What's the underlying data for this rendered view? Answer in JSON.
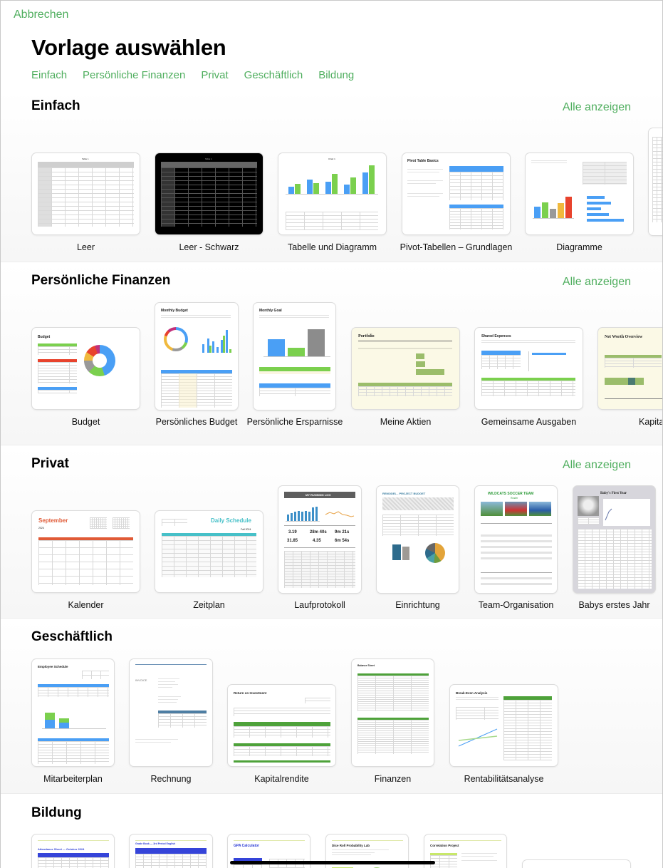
{
  "header": {
    "cancel_label": "Abbrechen",
    "title": "Vorlage auswählen",
    "categories": [
      "Einfach",
      "Persönliche Finanzen",
      "Privat",
      "Geschäftlich",
      "Bildung"
    ]
  },
  "colors": {
    "accent": "#4fae5e",
    "background": "#ffffff",
    "section_gradient_end": "#f6f6f6"
  },
  "sections": [
    {
      "title": "Einfach",
      "show_all": "Alle anzeigen",
      "templates": [
        {
          "label": "Leer",
          "preview_title": "Table 1"
        },
        {
          "label": "Leer - Schwarz",
          "preview_title": "Table 1"
        },
        {
          "label": "Tabelle und Diagramm",
          "preview_title": "Chart 1"
        },
        {
          "label": "Pivot-Tabellen – Grundlagen",
          "preview_title": "Pivot Table Basics"
        },
        {
          "label": "Diagramme",
          "preview_title": "Column Chart"
        }
      ]
    },
    {
      "title": "Persönliche Finanzen",
      "show_all": "Alle anzeigen",
      "templates": [
        {
          "label": "Budget",
          "preview_title": "Budget"
        },
        {
          "label": "Persönliches Budget",
          "preview_title": "Monthly Budget"
        },
        {
          "label": "Persönliche Ersparnisse",
          "preview_title": "Monthly Goal"
        },
        {
          "label": "Meine Aktien",
          "preview_title": "Portfolio"
        },
        {
          "label": "Gemeinsame Ausgaben",
          "preview_title": "Shared Expenses"
        },
        {
          "label": "Kapita",
          "preview_title": "Net Worth Overview"
        }
      ]
    },
    {
      "title": "Privat",
      "show_all": "Alle anzeigen",
      "templates": [
        {
          "label": "Kalender",
          "preview_title": "September",
          "preview_sub": "2024"
        },
        {
          "label": "Zeitplan",
          "preview_title": "Daily Schedule",
          "preview_sub": "Fall 2024"
        },
        {
          "label": "Laufprotokoll",
          "preview_title": "MY RUNNING LOG",
          "stats": [
            "3.19",
            "28m 40s",
            "9m 21s",
            "31.85",
            "4.35",
            "6m 54s"
          ]
        },
        {
          "label": "Einrichtung",
          "preview_title": "REMODEL - PROJECT BUDGET"
        },
        {
          "label": "Team-Organisation",
          "preview_title": "WILDCATS SOCCER TEAM",
          "preview_sub": "Roster"
        },
        {
          "label": "Babys erstes Jahr",
          "preview_title": "Baby's First Year"
        }
      ]
    },
    {
      "title": "Geschäftlich",
      "templates": [
        {
          "label": "Mitarbeiterplan",
          "preview_title": "Employee Schedule"
        },
        {
          "label": "Rechnung",
          "preview_title": "INVOICE"
        },
        {
          "label": "Kapitalrendite",
          "preview_title": "Return on Investment"
        },
        {
          "label": "Finanzen",
          "preview_title": "Balance Sheet"
        },
        {
          "label": "Rentabilitätsanalyse",
          "preview_title": "Break-Even Analysis"
        }
      ]
    },
    {
      "title": "Bildung",
      "templates": [
        {
          "label": "",
          "preview_title": "Attendance Sheet — October 2024"
        },
        {
          "label": "",
          "preview_title": "Grade Book — 3rd Period English"
        },
        {
          "label": "",
          "preview_title": "GPA Calculator"
        },
        {
          "label": "",
          "preview_title": "Dice Roll Probability Lab"
        },
        {
          "label": "",
          "preview_title": "Correlation Project"
        }
      ]
    }
  ]
}
